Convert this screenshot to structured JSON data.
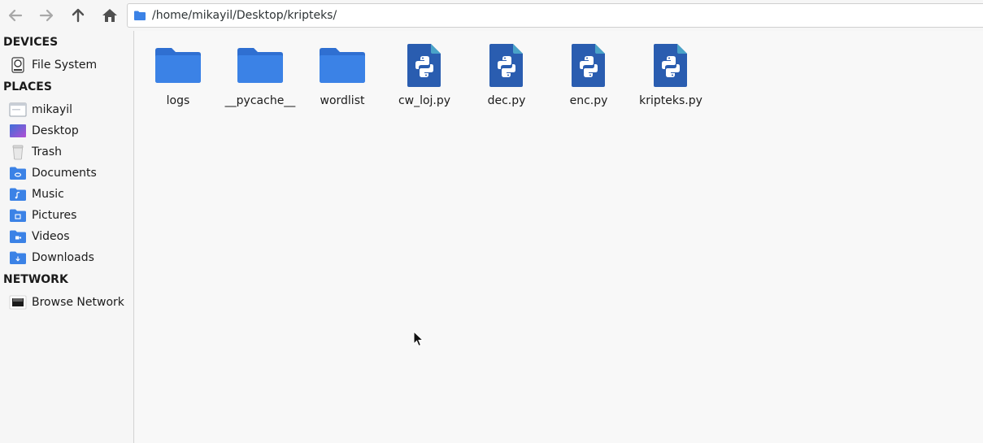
{
  "toolbar": {
    "back_icon": "arrow-left-icon",
    "forward_icon": "arrow-right-icon",
    "up_icon": "arrow-up-icon",
    "home_icon": "home-icon",
    "location_path": "/home/mikayil/Desktop/kripteks/"
  },
  "sidebar": {
    "devices_header": "DEVICES",
    "devices": [
      {
        "label": "File System",
        "icon": "harddisk-icon"
      }
    ],
    "places_header": "PLACES",
    "places": [
      {
        "label": "mikayil",
        "icon": "home-folder-icon"
      },
      {
        "label": "Desktop",
        "icon": "desktop-icon"
      },
      {
        "label": "Trash",
        "icon": "trash-icon"
      },
      {
        "label": "Documents",
        "icon": "documents-folder-icon"
      },
      {
        "label": "Music",
        "icon": "music-folder-icon"
      },
      {
        "label": "Pictures",
        "icon": "pictures-folder-icon"
      },
      {
        "label": "Videos",
        "icon": "videos-folder-icon"
      },
      {
        "label": "Downloads",
        "icon": "downloads-folder-icon"
      }
    ],
    "network_header": "NETWORK",
    "network": [
      {
        "label": "Browse Network",
        "icon": "network-icon"
      }
    ]
  },
  "files": [
    {
      "name": "logs",
      "type": "folder"
    },
    {
      "name": "__pycache__",
      "type": "folder"
    },
    {
      "name": "wordlist",
      "type": "folder"
    },
    {
      "name": "cw_loj.py",
      "type": "python"
    },
    {
      "name": "dec.py",
      "type": "python"
    },
    {
      "name": "enc.py",
      "type": "python"
    },
    {
      "name": "kripteks.py",
      "type": "python"
    }
  ],
  "colors": {
    "folder_blue": "#3b82e6",
    "python_blue": "#2a5db0",
    "python_corner": "#4aa3c8"
  }
}
